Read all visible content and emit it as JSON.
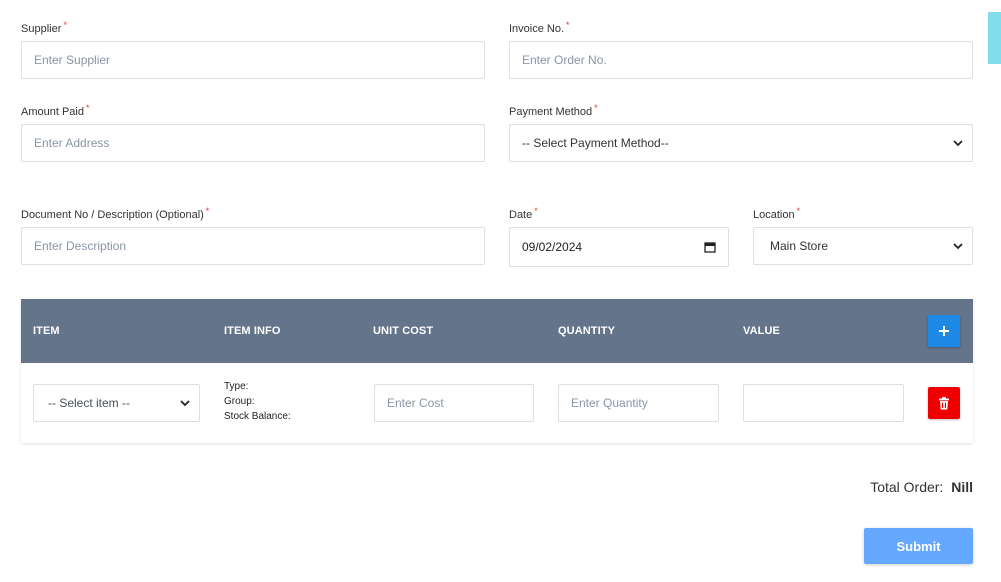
{
  "form": {
    "supplier": {
      "label": "Supplier",
      "placeholder": "Enter Supplier"
    },
    "invoice": {
      "label": "Invoice No.",
      "placeholder": "Enter Order No."
    },
    "amount_paid": {
      "label": "Amount Paid",
      "placeholder": "Enter Address"
    },
    "payment_method": {
      "label": "Payment Method",
      "value": "-- Select Payment Method--"
    },
    "document": {
      "label": "Document No / Description (Optional)",
      "placeholder": "Enter Description"
    },
    "date": {
      "label": "Date",
      "value": "09/02/2024"
    },
    "location": {
      "label": "Location",
      "value": "Main Store"
    },
    "required_mark": "*"
  },
  "table": {
    "headers": [
      "ITEM",
      "ITEM INFO",
      "UNIT COST",
      "QUANTITY",
      "VALUE"
    ],
    "row": {
      "item_select": "-- Select item --",
      "info": [
        "Type:",
        "Group:",
        "Stock Balance:"
      ],
      "cost_placeholder": "Enter Cost",
      "quantity_placeholder": "Enter Quantity",
      "value": ""
    },
    "add_icon": "plus-icon",
    "delete_icon": "trash-icon"
  },
  "summary": {
    "total_label": "Total Order:",
    "total_value": "Nill"
  },
  "actions": {
    "submit_label": "Submit"
  },
  "colors": {
    "table_header": "#64748b",
    "add_button": "#1e88e5",
    "delete_button": "#ee0000",
    "submit_button": "#64a8ff",
    "required": "#e53935"
  }
}
